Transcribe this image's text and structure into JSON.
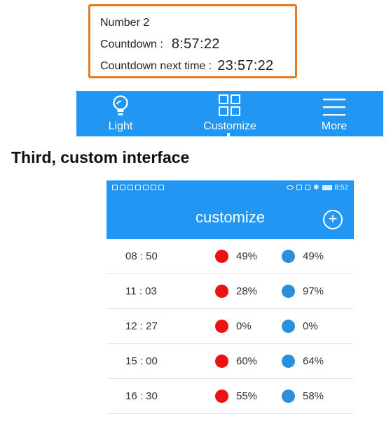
{
  "countdown": {
    "title": "Number 2",
    "countdown_label": "Countdown :",
    "countdown_value": "8:57:22",
    "next_label": "Countdown next time :",
    "next_value": "23:57:22",
    "border_color": "#e07a26"
  },
  "bottom_nav": {
    "background": "#2196f3",
    "items": [
      {
        "label": "Light",
        "icon": "bulb-icon"
      },
      {
        "label": "Customize",
        "icon": "grid-icon"
      },
      {
        "label": "More",
        "icon": "menu-icon"
      }
    ]
  },
  "section_heading": "Third, custom interface",
  "phone": {
    "status_time": "8:52",
    "title": "customize",
    "add_icon": "plus-circle-icon",
    "rows": [
      {
        "time": "08 : 50",
        "red": "49%",
        "blue": "49%"
      },
      {
        "time": "11 : 03",
        "red": "28%",
        "blue": "97%"
      },
      {
        "time": "12 : 27",
        "red": "0%",
        "blue": "0%"
      },
      {
        "time": "15 : 00",
        "red": "60%",
        "blue": "64%"
      },
      {
        "time": "16 : 30",
        "red": "55%",
        "blue": "58%"
      }
    ],
    "colors": {
      "header": "#2196f3",
      "red_dot": "#ee1111",
      "blue_dot": "#2b8fdc"
    }
  }
}
